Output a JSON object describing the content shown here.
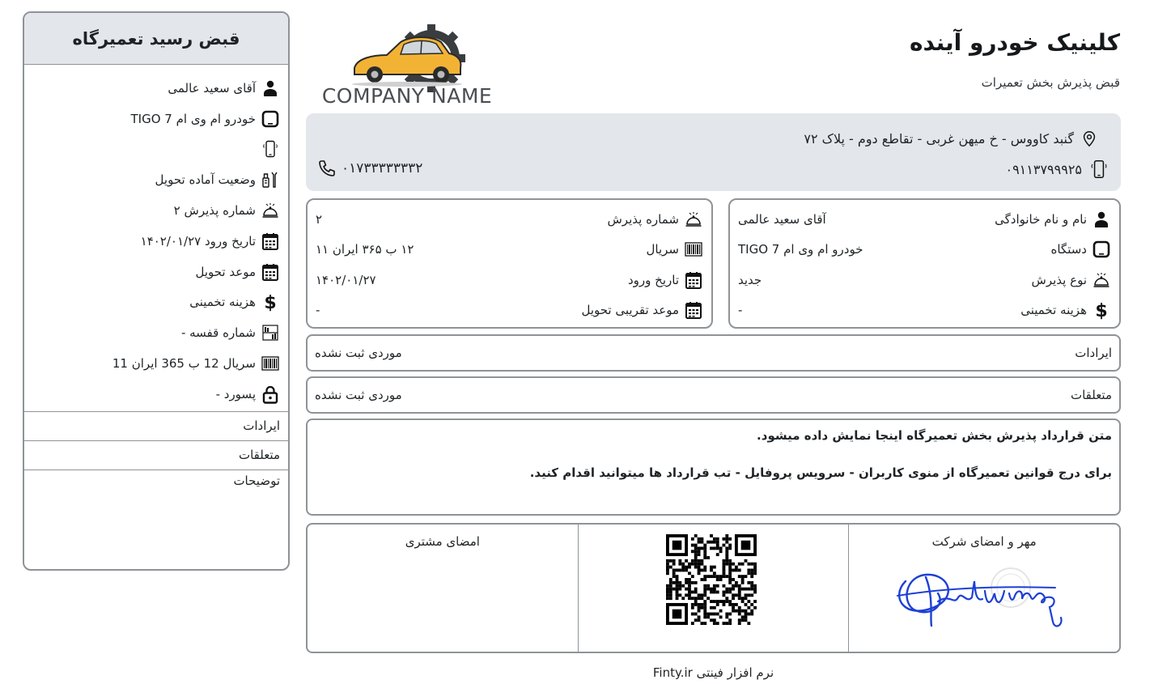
{
  "stub": {
    "title": "قبض رسید تعمیرگاه",
    "rows": [
      {
        "icon": "user-icon",
        "text": "آقای سعید عالمی"
      },
      {
        "icon": "tablet-icon",
        "text": "خودرو ام وی ام TIGO 7"
      },
      {
        "icon": "mobile-phone-icon",
        "text": ""
      },
      {
        "icon": "tools-icon",
        "text": "وضعیت آماده تحویل"
      },
      {
        "icon": "service-bell-icon",
        "text": "شماره پذیرش ۲"
      },
      {
        "icon": "calendar-icon",
        "text": "تاریخ ورود ۱۴۰۲/۰۱/۲۷"
      },
      {
        "icon": "calendar-icon",
        "text": "موعد تحویل"
      },
      {
        "icon": "dollar-icon",
        "text": "هزینه تخمینی"
      },
      {
        "icon": "shelf-icon",
        "text": "شماره قفسه -"
      },
      {
        "icon": "barcode-icon",
        "text": "سریال 12 ب 365 ایران 11"
      },
      {
        "icon": "lock-icon",
        "text": "پسورد -"
      }
    ],
    "sections": {
      "defects": "ایرادات",
      "accessories": "متعلقات",
      "notes": "توضیحات"
    }
  },
  "header": {
    "title": "کلینیک خودرو آینده",
    "subtitle": "قبض پذیرش بخش تعمیرات",
    "logo_text": "COMPANY NAME"
  },
  "band": {
    "address": "گنبد کاووس - خ میهن غربی - تقاطع دوم - پلاک ۷۲",
    "mobile": "۰۹۱۱۳۷۹۹۹۲۵",
    "phone": "۰۱۷۳۳۳۳۳۳۳۲"
  },
  "customer": {
    "rows": [
      {
        "icon": "user-icon",
        "label": "نام و نام خانوادگی",
        "value": "آقای سعید عالمی"
      },
      {
        "icon": "tablet-icon",
        "label": "دستگاه",
        "value": "خودرو ام وی ام TIGO 7"
      },
      {
        "icon": "service-bell-icon",
        "label": "نوع پذیرش",
        "value": "جدید"
      },
      {
        "icon": "dollar-icon",
        "label": "هزینه تخمینی",
        "value": "-"
      }
    ]
  },
  "reception": {
    "rows": [
      {
        "icon": "service-bell-icon",
        "label": "شماره پذیرش",
        "value": "۲"
      },
      {
        "icon": "barcode-icon",
        "label": "سریال",
        "value": "۱۲ ب ۳۶۵ ایران ۱۱"
      },
      {
        "icon": "calendar-icon",
        "label": "تاریخ ورود",
        "value": "۱۴۰۲/۰۱/۲۷"
      },
      {
        "icon": "calendar-icon",
        "label": "موعد تقریبی تحویل",
        "value": "-"
      }
    ]
  },
  "defects": {
    "label": "ایرادات",
    "value": "موردی ثبت نشده"
  },
  "accessories": {
    "label": "متعلقات",
    "value": "موردی ثبت نشده"
  },
  "contract": {
    "line1": "متن قرارداد پذیرش بخش تعمیرگاه اینجا نمایش داده میشود.",
    "line2": "برای درج قوانین تعمیرگاه از منوی کاربران - سرویس پروفایل - تب قرارداد ها میتوانید اقدام کنید."
  },
  "signatures": {
    "company": "مهر و امضای شرکت",
    "customer": "امضای مشتری"
  },
  "footer": "نرم افزار فینتی Finty.ir",
  "colors": {
    "band": "#e3e6ea",
    "border": "#8f9397",
    "signature_ink": "#1d3fd6",
    "car": "#f2b335"
  }
}
